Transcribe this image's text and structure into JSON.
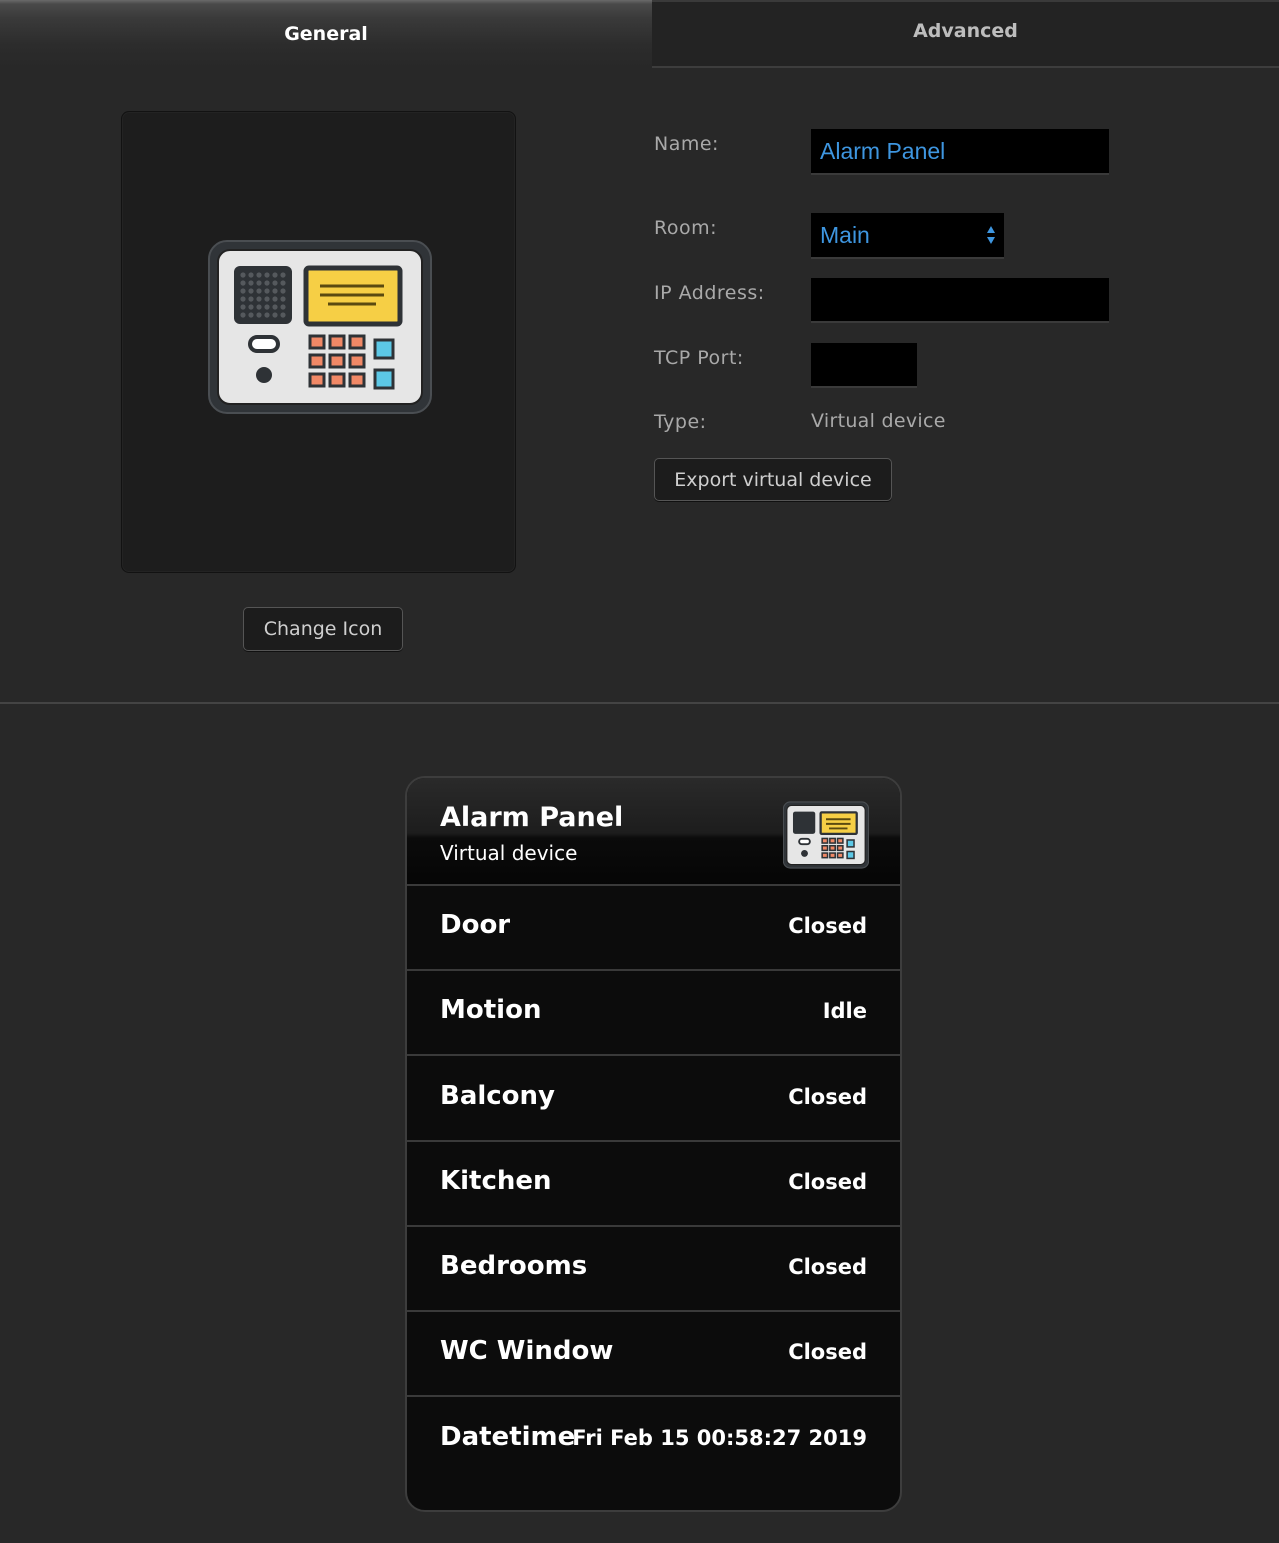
{
  "tabs": [
    {
      "label": "General",
      "active": true
    },
    {
      "label": "Advanced",
      "active": false
    }
  ],
  "icon_panel": {
    "icon": "alarm-panel-icon",
    "change_icon_label": "Change Icon"
  },
  "form": {
    "name_label": "Name:",
    "name_value": "Alarm Panel",
    "room_label": "Room:",
    "room_value": "Main",
    "ip_label": "IP Address:",
    "ip_value": "",
    "port_label": "TCP Port:",
    "port_value": "",
    "type_label": "Type:",
    "type_value": "Virtual device",
    "export_label": "Export virtual device"
  },
  "widget": {
    "title": "Alarm Panel",
    "subtitle": "Virtual device",
    "rows": [
      {
        "label": "Door",
        "value": "Closed"
      },
      {
        "label": "Motion",
        "value": "Idle"
      },
      {
        "label": "Balcony",
        "value": "Closed"
      },
      {
        "label": "Kitchen",
        "value": "Closed"
      },
      {
        "label": "Bedrooms",
        "value": "Closed"
      },
      {
        "label": "WC Window",
        "value": "Closed"
      },
      {
        "label": "Datetime",
        "value": "Fri Feb 15 00:58:27 2019"
      }
    ]
  },
  "colors": {
    "background": "#282828",
    "input_text": "#3e96e0",
    "card_background": "#0c0c0c"
  }
}
